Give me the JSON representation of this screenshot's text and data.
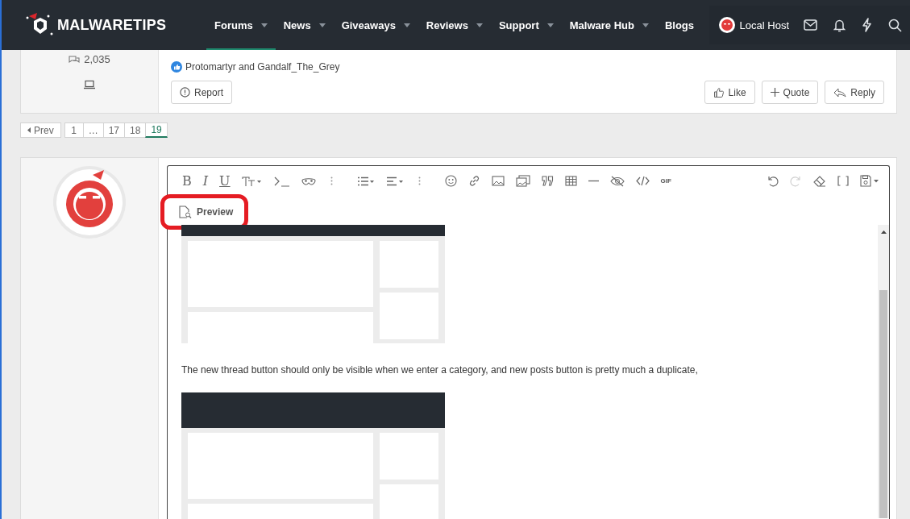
{
  "header": {
    "logo": "MALWARETIPS",
    "nav": [
      {
        "label": "Forums",
        "dropdown": true,
        "selected": true
      },
      {
        "label": "News",
        "dropdown": true,
        "selected": false
      },
      {
        "label": "Giveaways",
        "dropdown": true,
        "selected": false
      },
      {
        "label": "Reviews",
        "dropdown": true,
        "selected": false
      },
      {
        "label": "Support",
        "dropdown": true,
        "selected": false
      },
      {
        "label": "Malware Hub",
        "dropdown": true,
        "selected": false
      },
      {
        "label": "Blogs",
        "dropdown": false,
        "selected": false
      }
    ],
    "user": "Local Host"
  },
  "previous_post": {
    "message_count": "2,035",
    "reactions": "Protomartyr and Gandalf_The_Grey",
    "report": "Report",
    "actions": [
      "Like",
      "Quote",
      "Reply"
    ]
  },
  "pagination": {
    "prev": "Prev",
    "pages": [
      {
        "label": "1",
        "selected": false
      },
      {
        "label": "…",
        "selected": false
      },
      {
        "label": "17",
        "selected": false
      },
      {
        "label": "18",
        "selected": false
      },
      {
        "label": "19",
        "selected": true
      }
    ]
  },
  "editor": {
    "format_buttons": [
      "B",
      "I",
      "U"
    ],
    "gif": "GIF",
    "redo_disabled": true,
    "preview": "Preview",
    "text": "The new thread button should only be visible when we enter a category, and new posts button is pretty much a duplicate,"
  }
}
